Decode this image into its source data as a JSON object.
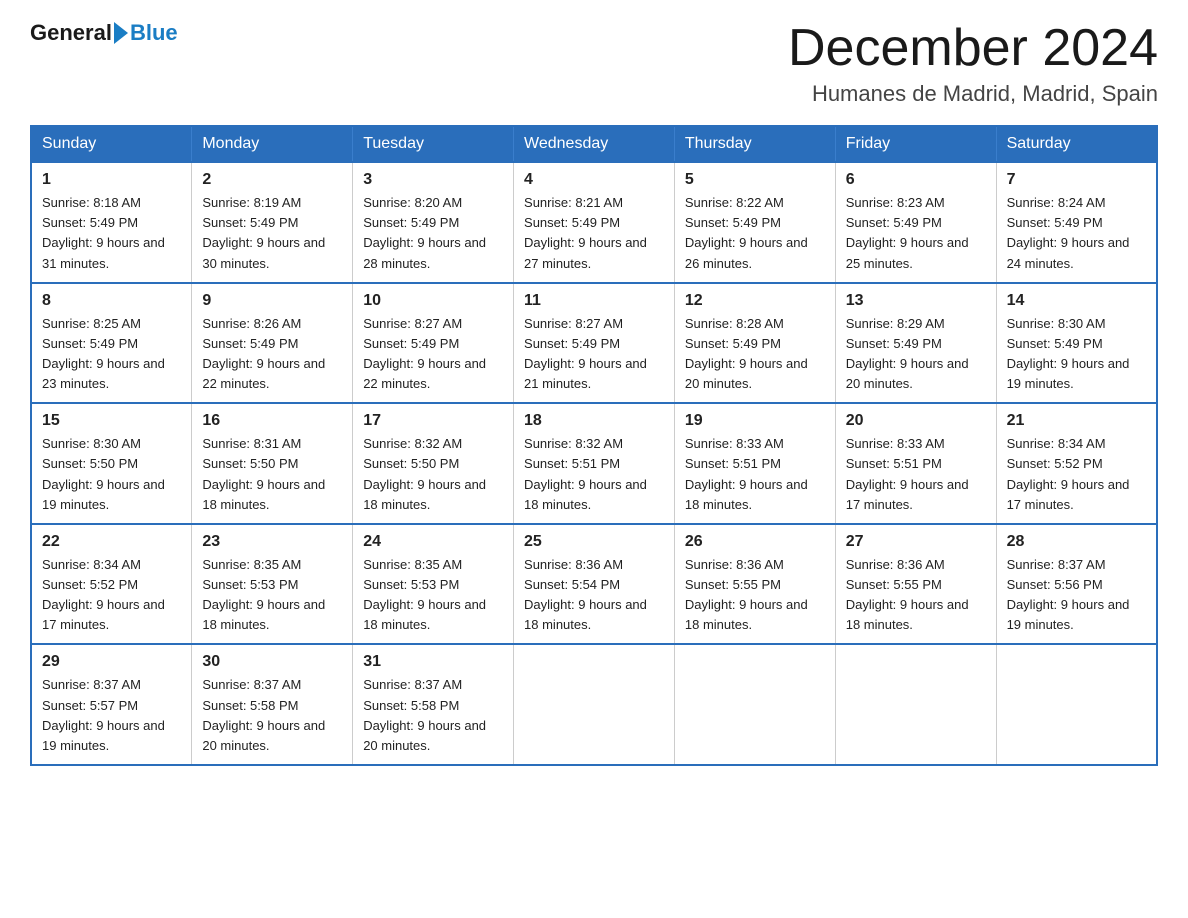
{
  "header": {
    "logo_general": "General",
    "logo_blue": "Blue",
    "month_title": "December 2024",
    "location": "Humanes de Madrid, Madrid, Spain"
  },
  "days_of_week": [
    "Sunday",
    "Monday",
    "Tuesday",
    "Wednesday",
    "Thursday",
    "Friday",
    "Saturday"
  ],
  "weeks": [
    [
      {
        "day": "1",
        "sunrise": "8:18 AM",
        "sunset": "5:49 PM",
        "daylight": "9 hours and 31 minutes."
      },
      {
        "day": "2",
        "sunrise": "8:19 AM",
        "sunset": "5:49 PM",
        "daylight": "9 hours and 30 minutes."
      },
      {
        "day": "3",
        "sunrise": "8:20 AM",
        "sunset": "5:49 PM",
        "daylight": "9 hours and 28 minutes."
      },
      {
        "day": "4",
        "sunrise": "8:21 AM",
        "sunset": "5:49 PM",
        "daylight": "9 hours and 27 minutes."
      },
      {
        "day": "5",
        "sunrise": "8:22 AM",
        "sunset": "5:49 PM",
        "daylight": "9 hours and 26 minutes."
      },
      {
        "day": "6",
        "sunrise": "8:23 AM",
        "sunset": "5:49 PM",
        "daylight": "9 hours and 25 minutes."
      },
      {
        "day": "7",
        "sunrise": "8:24 AM",
        "sunset": "5:49 PM",
        "daylight": "9 hours and 24 minutes."
      }
    ],
    [
      {
        "day": "8",
        "sunrise": "8:25 AM",
        "sunset": "5:49 PM",
        "daylight": "9 hours and 23 minutes."
      },
      {
        "day": "9",
        "sunrise": "8:26 AM",
        "sunset": "5:49 PM",
        "daylight": "9 hours and 22 minutes."
      },
      {
        "day": "10",
        "sunrise": "8:27 AM",
        "sunset": "5:49 PM",
        "daylight": "9 hours and 22 minutes."
      },
      {
        "day": "11",
        "sunrise": "8:27 AM",
        "sunset": "5:49 PM",
        "daylight": "9 hours and 21 minutes."
      },
      {
        "day": "12",
        "sunrise": "8:28 AM",
        "sunset": "5:49 PM",
        "daylight": "9 hours and 20 minutes."
      },
      {
        "day": "13",
        "sunrise": "8:29 AM",
        "sunset": "5:49 PM",
        "daylight": "9 hours and 20 minutes."
      },
      {
        "day": "14",
        "sunrise": "8:30 AM",
        "sunset": "5:49 PM",
        "daylight": "9 hours and 19 minutes."
      }
    ],
    [
      {
        "day": "15",
        "sunrise": "8:30 AM",
        "sunset": "5:50 PM",
        "daylight": "9 hours and 19 minutes."
      },
      {
        "day": "16",
        "sunrise": "8:31 AM",
        "sunset": "5:50 PM",
        "daylight": "9 hours and 18 minutes."
      },
      {
        "day": "17",
        "sunrise": "8:32 AM",
        "sunset": "5:50 PM",
        "daylight": "9 hours and 18 minutes."
      },
      {
        "day": "18",
        "sunrise": "8:32 AM",
        "sunset": "5:51 PM",
        "daylight": "9 hours and 18 minutes."
      },
      {
        "day": "19",
        "sunrise": "8:33 AM",
        "sunset": "5:51 PM",
        "daylight": "9 hours and 18 minutes."
      },
      {
        "day": "20",
        "sunrise": "8:33 AM",
        "sunset": "5:51 PM",
        "daylight": "9 hours and 17 minutes."
      },
      {
        "day": "21",
        "sunrise": "8:34 AM",
        "sunset": "5:52 PM",
        "daylight": "9 hours and 17 minutes."
      }
    ],
    [
      {
        "day": "22",
        "sunrise": "8:34 AM",
        "sunset": "5:52 PM",
        "daylight": "9 hours and 17 minutes."
      },
      {
        "day": "23",
        "sunrise": "8:35 AM",
        "sunset": "5:53 PM",
        "daylight": "9 hours and 18 minutes."
      },
      {
        "day": "24",
        "sunrise": "8:35 AM",
        "sunset": "5:53 PM",
        "daylight": "9 hours and 18 minutes."
      },
      {
        "day": "25",
        "sunrise": "8:36 AM",
        "sunset": "5:54 PM",
        "daylight": "9 hours and 18 minutes."
      },
      {
        "day": "26",
        "sunrise": "8:36 AM",
        "sunset": "5:55 PM",
        "daylight": "9 hours and 18 minutes."
      },
      {
        "day": "27",
        "sunrise": "8:36 AM",
        "sunset": "5:55 PM",
        "daylight": "9 hours and 18 minutes."
      },
      {
        "day": "28",
        "sunrise": "8:37 AM",
        "sunset": "5:56 PM",
        "daylight": "9 hours and 19 minutes."
      }
    ],
    [
      {
        "day": "29",
        "sunrise": "8:37 AM",
        "sunset": "5:57 PM",
        "daylight": "9 hours and 19 minutes."
      },
      {
        "day": "30",
        "sunrise": "8:37 AM",
        "sunset": "5:58 PM",
        "daylight": "9 hours and 20 minutes."
      },
      {
        "day": "31",
        "sunrise": "8:37 AM",
        "sunset": "5:58 PM",
        "daylight": "9 hours and 20 minutes."
      },
      null,
      null,
      null,
      null
    ]
  ]
}
